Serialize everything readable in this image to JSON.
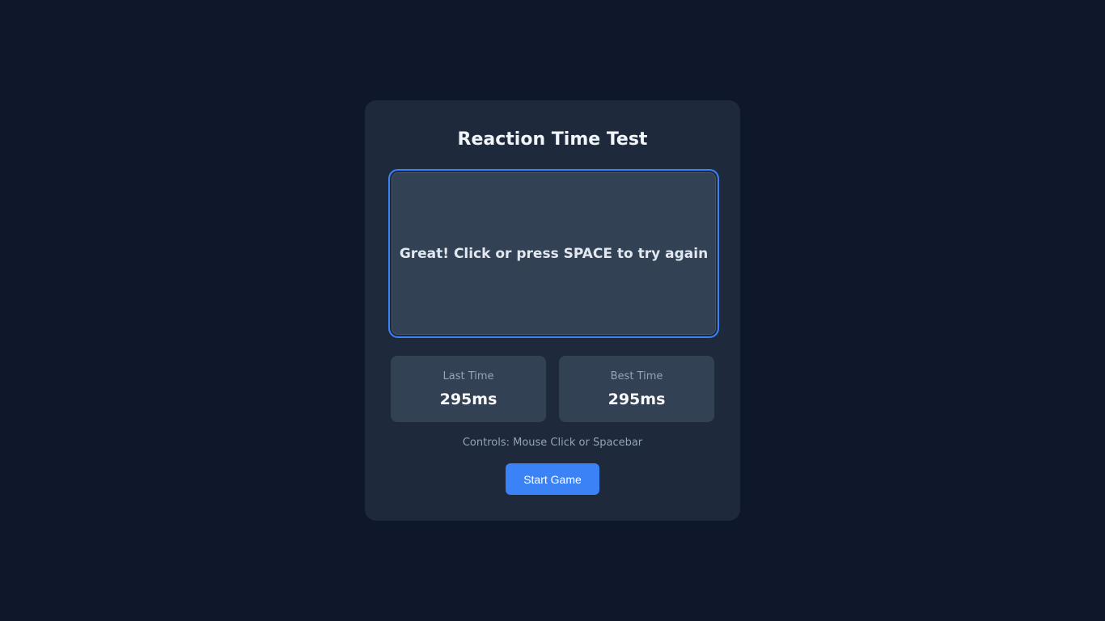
{
  "game": {
    "title": "Reaction Time Test",
    "message": "Great! Click or press SPACE to try again",
    "stats": {
      "last_label": "Last Time",
      "last_value": "295ms",
      "best_label": "Best Time",
      "best_value": "295ms"
    },
    "controls": "Controls: Mouse Click or Spacebar",
    "start_button": "Start Game"
  },
  "colors": {
    "background": "#0f172a",
    "card": "#1e293b",
    "panel": "#334155",
    "accent": "#3b82f6"
  }
}
